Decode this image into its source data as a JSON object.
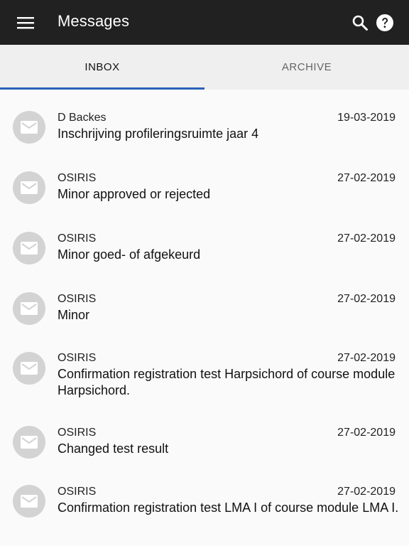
{
  "header": {
    "title": "Messages",
    "menu_icon": "menu-icon",
    "search_icon": "search-icon",
    "help_icon": "help-icon"
  },
  "tabs": [
    {
      "label": "INBOX",
      "active": true
    },
    {
      "label": "ARCHIVE",
      "active": false
    }
  ],
  "accent_color": "#2a62b8",
  "messages": [
    {
      "sender": "D Backes",
      "date": "19-03-2019",
      "subject": "Inschrijving profileringsruimte jaar 4"
    },
    {
      "sender": "OSIRIS",
      "date": "27-02-2019",
      "subject": "Minor approved or rejected"
    },
    {
      "sender": "OSIRIS",
      "date": "27-02-2019",
      "subject": "Minor goed- of afgekeurd"
    },
    {
      "sender": "OSIRIS",
      "date": "27-02-2019",
      "subject": "Minor"
    },
    {
      "sender": "OSIRIS",
      "date": "27-02-2019",
      "subject": "Confirmation registration test Harpsichord of course module Harpsichord."
    },
    {
      "sender": "OSIRIS",
      "date": "27-02-2019",
      "subject": "Changed test result"
    },
    {
      "sender": "OSIRIS",
      "date": "27-02-2019",
      "subject": "Confirmation registration test LMA I of course module LMA I."
    }
  ]
}
